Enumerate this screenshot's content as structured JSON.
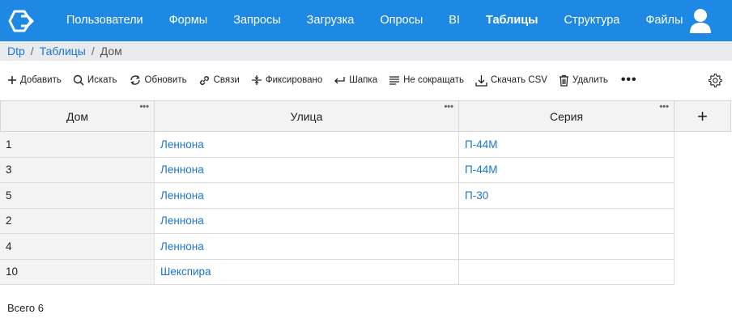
{
  "nav": {
    "items": [
      "Пользователи",
      "Формы",
      "Запросы",
      "Загрузка",
      "Опросы",
      "BI",
      "Таблицы",
      "Структура",
      "Файлы"
    ],
    "active_index": 6
  },
  "breadcrumb": {
    "items": [
      "Dtp",
      "Таблицы"
    ],
    "current": "Дом",
    "separator": "/"
  },
  "toolbar": {
    "add": "Добавить",
    "search": "Искать",
    "refresh": "Обновить",
    "links": "Связи",
    "fixed": "Фиксировано",
    "header": "Шапка",
    "no_truncate": "Не сокращать",
    "download_csv": "Скачать CSV",
    "delete": "Удалить",
    "more": "•••"
  },
  "table": {
    "columns": [
      "Дом",
      "Улица",
      "Серия"
    ],
    "add_column": "+",
    "column_menu": "•••",
    "rows": [
      [
        "1",
        "Леннона",
        "П-44М"
      ],
      [
        "3",
        "Леннона",
        "П-44М"
      ],
      [
        "5",
        "Леннона",
        "П-30"
      ],
      [
        "2",
        "Леннона",
        ""
      ],
      [
        "4",
        "Леннона",
        ""
      ],
      [
        "10",
        "Шекспира",
        ""
      ]
    ]
  },
  "footer": {
    "total": "Всего 6"
  },
  "colors": {
    "accent": "#1e88e5",
    "link": "#1976d2",
    "header_bg": "#f3f3f3",
    "breadcrumb_bg": "#e8eaed"
  },
  "icons": [
    "logo-icon",
    "user-icon",
    "plus-icon",
    "search-icon",
    "refresh-icon",
    "link-icon",
    "freeze-icon",
    "return-icon",
    "lines-icon",
    "download-icon",
    "trash-icon",
    "gear-icon"
  ]
}
